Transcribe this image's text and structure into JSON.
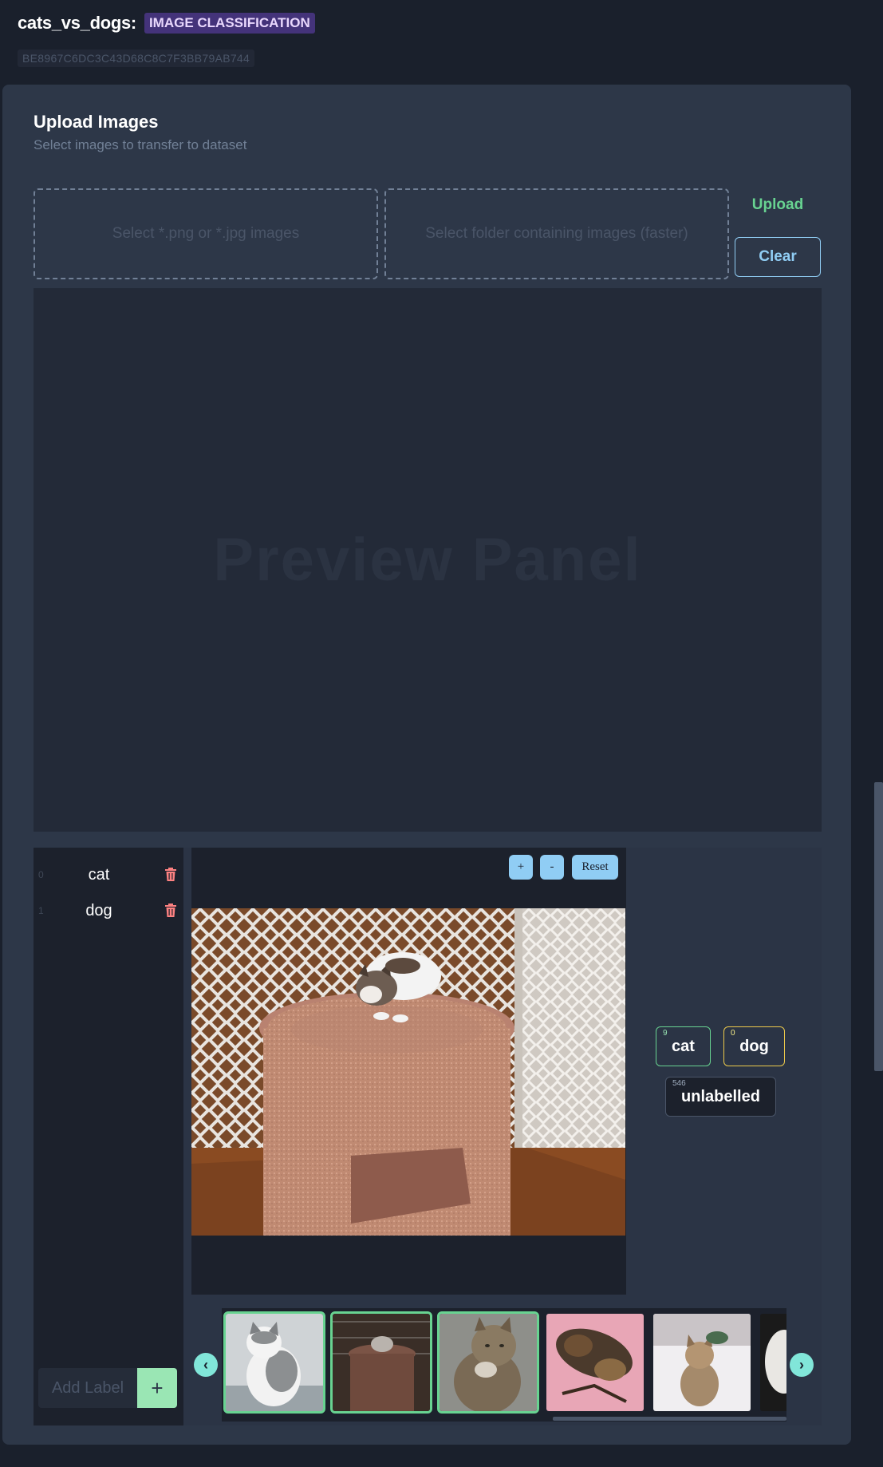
{
  "header": {
    "dataset_name": "cats_vs_dogs:",
    "dataset_type": "IMAGE CLASSIFICATION",
    "dataset_id": "BE8967C6DC3C43D68C8C7F3BB79AB744"
  },
  "upload": {
    "title": "Upload Images",
    "subtitle": "Select images to transfer to dataset",
    "files_placeholder": "Select *.png or *.jpg images",
    "folder_placeholder": "Select folder containing images (faster)",
    "upload_label": "Upload",
    "clear_label": "Clear",
    "preview_label": "Preview Panel"
  },
  "labels": {
    "items": [
      {
        "index": "0",
        "name": "cat",
        "icon": "trash-icon"
      },
      {
        "index": "1",
        "name": "dog",
        "icon": "trash-icon"
      }
    ],
    "add_placeholder": "Add Label",
    "add_button": "+"
  },
  "viewer": {
    "zoom_in": "+",
    "zoom_out": "-",
    "reset": "Reset"
  },
  "classes": {
    "cat": {
      "label": "cat",
      "count": "9"
    },
    "dog": {
      "label": "dog",
      "count": "0"
    },
    "unlabelled": {
      "label": "unlabelled",
      "count": "546"
    }
  },
  "thumbnails": [
    {
      "subject": "grey-white cat",
      "labelled": true
    },
    {
      "subject": "kitten on scratching post",
      "labelled": true
    },
    {
      "subject": "tabby cat",
      "labelled": true
    },
    {
      "subject": "tortoiseshell cat",
      "labelled": false
    },
    {
      "subject": "tabby kitten",
      "labelled": false
    },
    {
      "subject": "white cat",
      "labelled": false
    }
  ],
  "nav": {
    "prev": "‹",
    "next": "›"
  },
  "colors": {
    "background": "#1a202c",
    "panel": "#2d3748",
    "accent_green": "#68d391",
    "accent_blue": "#90cdf4",
    "accent_purple": "#44337a",
    "delete_red": "#fc8181"
  }
}
